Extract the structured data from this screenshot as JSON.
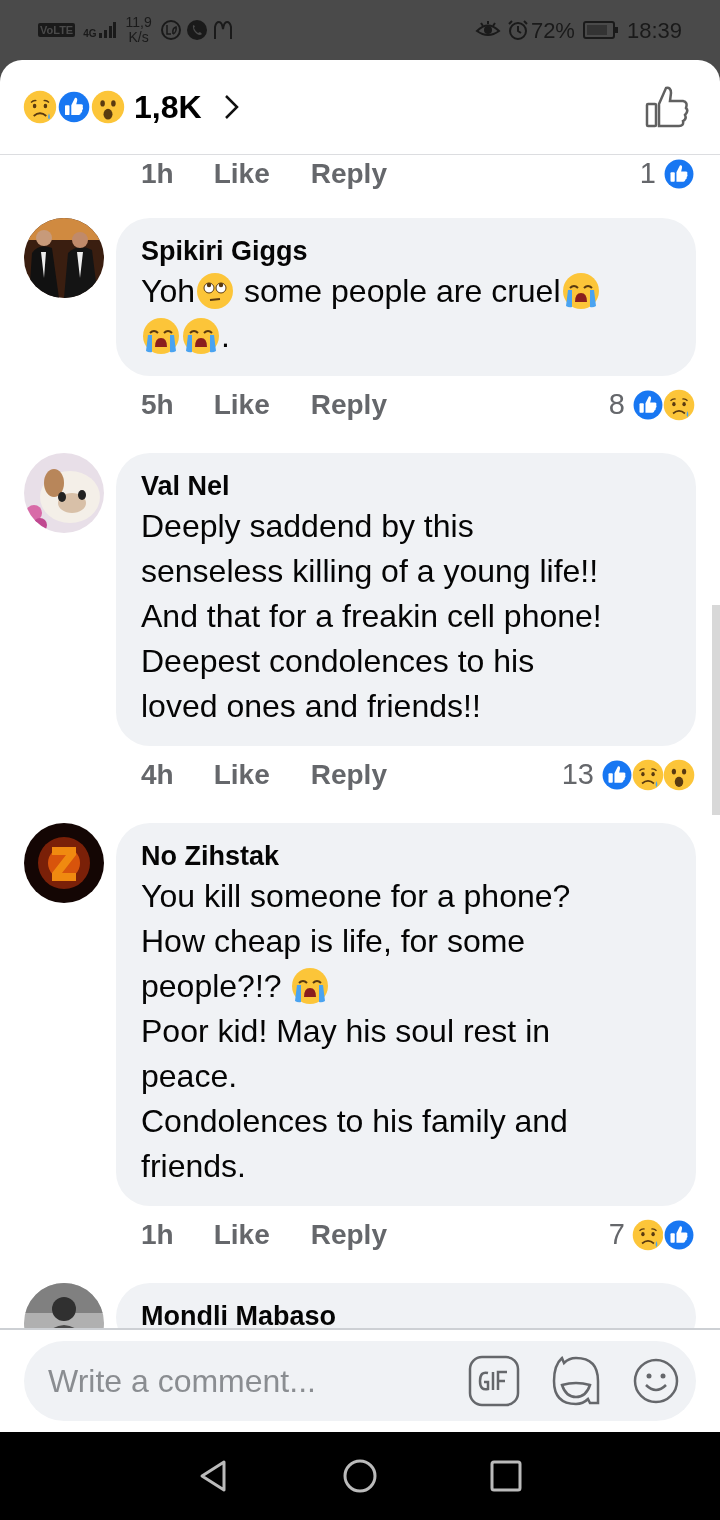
{
  "status_bar": {
    "volte": "VoLTE",
    "network": "4G",
    "speed": "11,9",
    "speed_unit": "K/s",
    "battery": "72%",
    "time": "18:39"
  },
  "header": {
    "reactions": [
      {
        "kind": "sad"
      },
      {
        "kind": "like"
      },
      {
        "kind": "wow"
      }
    ],
    "count": "1,8K"
  },
  "top_meta": {
    "time": "1h",
    "like": "Like",
    "reply": "Reply",
    "count": "1",
    "reactions": [
      {
        "kind": "like"
      }
    ]
  },
  "comments": [
    {
      "name": "Spikiri Giggs",
      "lines": [
        [
          {
            "kind": "text",
            "text": "Yoh"
          },
          {
            "kind": "eyeroll"
          },
          {
            "kind": "text",
            "text": " some people are cruel"
          },
          {
            "kind": "crying"
          }
        ],
        [
          {
            "kind": "crying"
          },
          {
            "kind": "crying"
          },
          {
            "kind": "text",
            "text": "."
          }
        ]
      ],
      "meta": {
        "time": "5h",
        "like": "Like",
        "reply": "Reply",
        "count": "8",
        "reactions": [
          {
            "kind": "like"
          },
          {
            "kind": "sad"
          }
        ]
      }
    },
    {
      "name": "Val Nel",
      "lines": [
        [
          {
            "kind": "text",
            "text": "Deeply saddend by this"
          }
        ],
        [
          {
            "kind": "text",
            "text": "senseless killing of a young life!!"
          }
        ],
        [
          {
            "kind": "text",
            "text": "And that for a freakin cell phone!"
          }
        ],
        [
          {
            "kind": "text",
            "text": "Deepest condolences to his"
          }
        ],
        [
          {
            "kind": "text",
            "text": "loved ones and friends!!"
          }
        ]
      ],
      "meta": {
        "time": "4h",
        "like": "Like",
        "reply": "Reply",
        "count": "13",
        "reactions": [
          {
            "kind": "like"
          },
          {
            "kind": "sad"
          },
          {
            "kind": "wow"
          }
        ]
      }
    },
    {
      "name": "No Zihstak",
      "lines": [
        [
          {
            "kind": "text",
            "text": "You kill someone for a phone?"
          }
        ],
        [
          {
            "kind": "text",
            "text": "How cheap is life, for some"
          }
        ],
        [
          {
            "kind": "text",
            "text": "people?!? "
          },
          {
            "kind": "crying"
          }
        ],
        [
          {
            "kind": "text",
            "text": "Poor kid! May his soul rest in"
          }
        ],
        [
          {
            "kind": "text",
            "text": "peace."
          }
        ],
        [
          {
            "kind": "text",
            "text": "Condolences to his family and"
          }
        ],
        [
          {
            "kind": "text",
            "text": "friends."
          }
        ]
      ],
      "meta": {
        "time": "1h",
        "like": "Like",
        "reply": "Reply",
        "count": "7",
        "reactions": [
          {
            "kind": "sad"
          },
          {
            "kind": "like"
          }
        ]
      }
    },
    {
      "name": "Mondli Mabaso"
    }
  ],
  "composer": {
    "placeholder": "Write a comment..."
  }
}
